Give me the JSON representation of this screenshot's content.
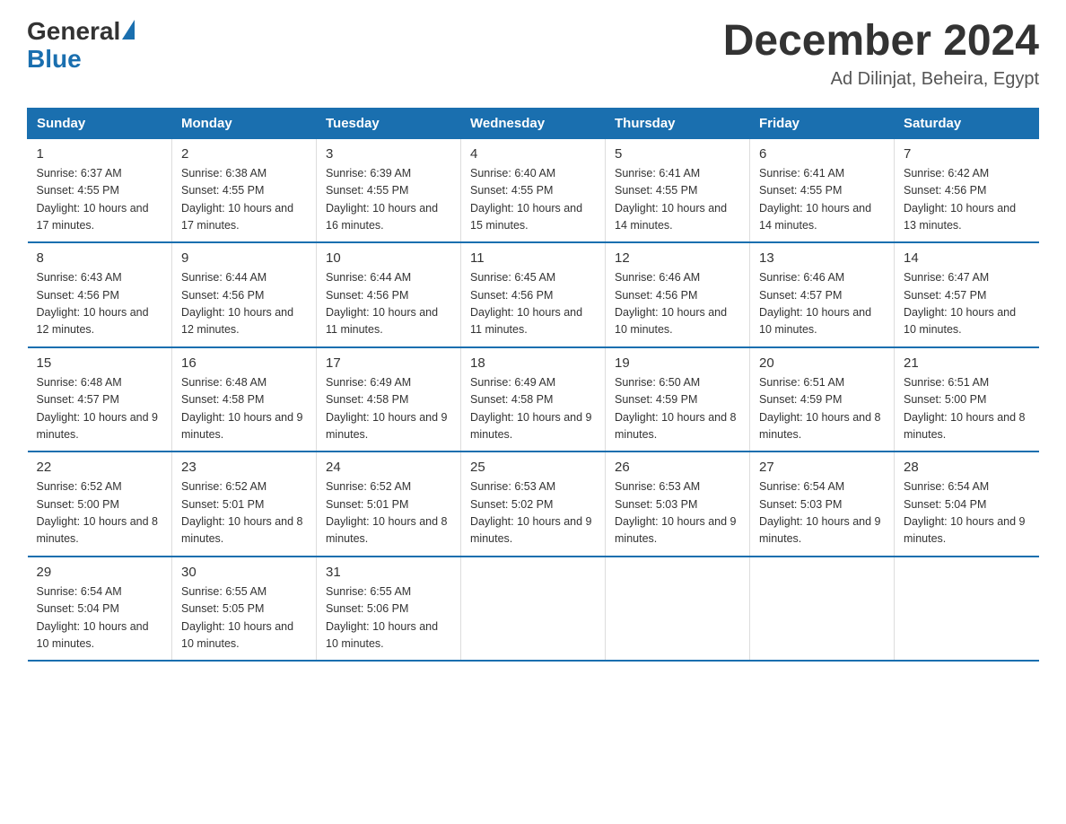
{
  "header": {
    "logo_general": "General",
    "logo_blue": "Blue",
    "month_title": "December 2024",
    "location": "Ad Dilinjat, Beheira, Egypt"
  },
  "days_of_week": [
    "Sunday",
    "Monday",
    "Tuesday",
    "Wednesday",
    "Thursday",
    "Friday",
    "Saturday"
  ],
  "weeks": [
    [
      {
        "day": "1",
        "sunrise": "6:37 AM",
        "sunset": "4:55 PM",
        "daylight": "10 hours and 17 minutes."
      },
      {
        "day": "2",
        "sunrise": "6:38 AM",
        "sunset": "4:55 PM",
        "daylight": "10 hours and 17 minutes."
      },
      {
        "day": "3",
        "sunrise": "6:39 AM",
        "sunset": "4:55 PM",
        "daylight": "10 hours and 16 minutes."
      },
      {
        "day": "4",
        "sunrise": "6:40 AM",
        "sunset": "4:55 PM",
        "daylight": "10 hours and 15 minutes."
      },
      {
        "day": "5",
        "sunrise": "6:41 AM",
        "sunset": "4:55 PM",
        "daylight": "10 hours and 14 minutes."
      },
      {
        "day": "6",
        "sunrise": "6:41 AM",
        "sunset": "4:55 PM",
        "daylight": "10 hours and 14 minutes."
      },
      {
        "day": "7",
        "sunrise": "6:42 AM",
        "sunset": "4:56 PM",
        "daylight": "10 hours and 13 minutes."
      }
    ],
    [
      {
        "day": "8",
        "sunrise": "6:43 AM",
        "sunset": "4:56 PM",
        "daylight": "10 hours and 12 minutes."
      },
      {
        "day": "9",
        "sunrise": "6:44 AM",
        "sunset": "4:56 PM",
        "daylight": "10 hours and 12 minutes."
      },
      {
        "day": "10",
        "sunrise": "6:44 AM",
        "sunset": "4:56 PM",
        "daylight": "10 hours and 11 minutes."
      },
      {
        "day": "11",
        "sunrise": "6:45 AM",
        "sunset": "4:56 PM",
        "daylight": "10 hours and 11 minutes."
      },
      {
        "day": "12",
        "sunrise": "6:46 AM",
        "sunset": "4:56 PM",
        "daylight": "10 hours and 10 minutes."
      },
      {
        "day": "13",
        "sunrise": "6:46 AM",
        "sunset": "4:57 PM",
        "daylight": "10 hours and 10 minutes."
      },
      {
        "day": "14",
        "sunrise": "6:47 AM",
        "sunset": "4:57 PM",
        "daylight": "10 hours and 10 minutes."
      }
    ],
    [
      {
        "day": "15",
        "sunrise": "6:48 AM",
        "sunset": "4:57 PM",
        "daylight": "10 hours and 9 minutes."
      },
      {
        "day": "16",
        "sunrise": "6:48 AM",
        "sunset": "4:58 PM",
        "daylight": "10 hours and 9 minutes."
      },
      {
        "day": "17",
        "sunrise": "6:49 AM",
        "sunset": "4:58 PM",
        "daylight": "10 hours and 9 minutes."
      },
      {
        "day": "18",
        "sunrise": "6:49 AM",
        "sunset": "4:58 PM",
        "daylight": "10 hours and 9 minutes."
      },
      {
        "day": "19",
        "sunrise": "6:50 AM",
        "sunset": "4:59 PM",
        "daylight": "10 hours and 8 minutes."
      },
      {
        "day": "20",
        "sunrise": "6:51 AM",
        "sunset": "4:59 PM",
        "daylight": "10 hours and 8 minutes."
      },
      {
        "day": "21",
        "sunrise": "6:51 AM",
        "sunset": "5:00 PM",
        "daylight": "10 hours and 8 minutes."
      }
    ],
    [
      {
        "day": "22",
        "sunrise": "6:52 AM",
        "sunset": "5:00 PM",
        "daylight": "10 hours and 8 minutes."
      },
      {
        "day": "23",
        "sunrise": "6:52 AM",
        "sunset": "5:01 PM",
        "daylight": "10 hours and 8 minutes."
      },
      {
        "day": "24",
        "sunrise": "6:52 AM",
        "sunset": "5:01 PM",
        "daylight": "10 hours and 8 minutes."
      },
      {
        "day": "25",
        "sunrise": "6:53 AM",
        "sunset": "5:02 PM",
        "daylight": "10 hours and 9 minutes."
      },
      {
        "day": "26",
        "sunrise": "6:53 AM",
        "sunset": "5:03 PM",
        "daylight": "10 hours and 9 minutes."
      },
      {
        "day": "27",
        "sunrise": "6:54 AM",
        "sunset": "5:03 PM",
        "daylight": "10 hours and 9 minutes."
      },
      {
        "day": "28",
        "sunrise": "6:54 AM",
        "sunset": "5:04 PM",
        "daylight": "10 hours and 9 minutes."
      }
    ],
    [
      {
        "day": "29",
        "sunrise": "6:54 AM",
        "sunset": "5:04 PM",
        "daylight": "10 hours and 10 minutes."
      },
      {
        "day": "30",
        "sunrise": "6:55 AM",
        "sunset": "5:05 PM",
        "daylight": "10 hours and 10 minutes."
      },
      {
        "day": "31",
        "sunrise": "6:55 AM",
        "sunset": "5:06 PM",
        "daylight": "10 hours and 10 minutes."
      },
      null,
      null,
      null,
      null
    ]
  ]
}
